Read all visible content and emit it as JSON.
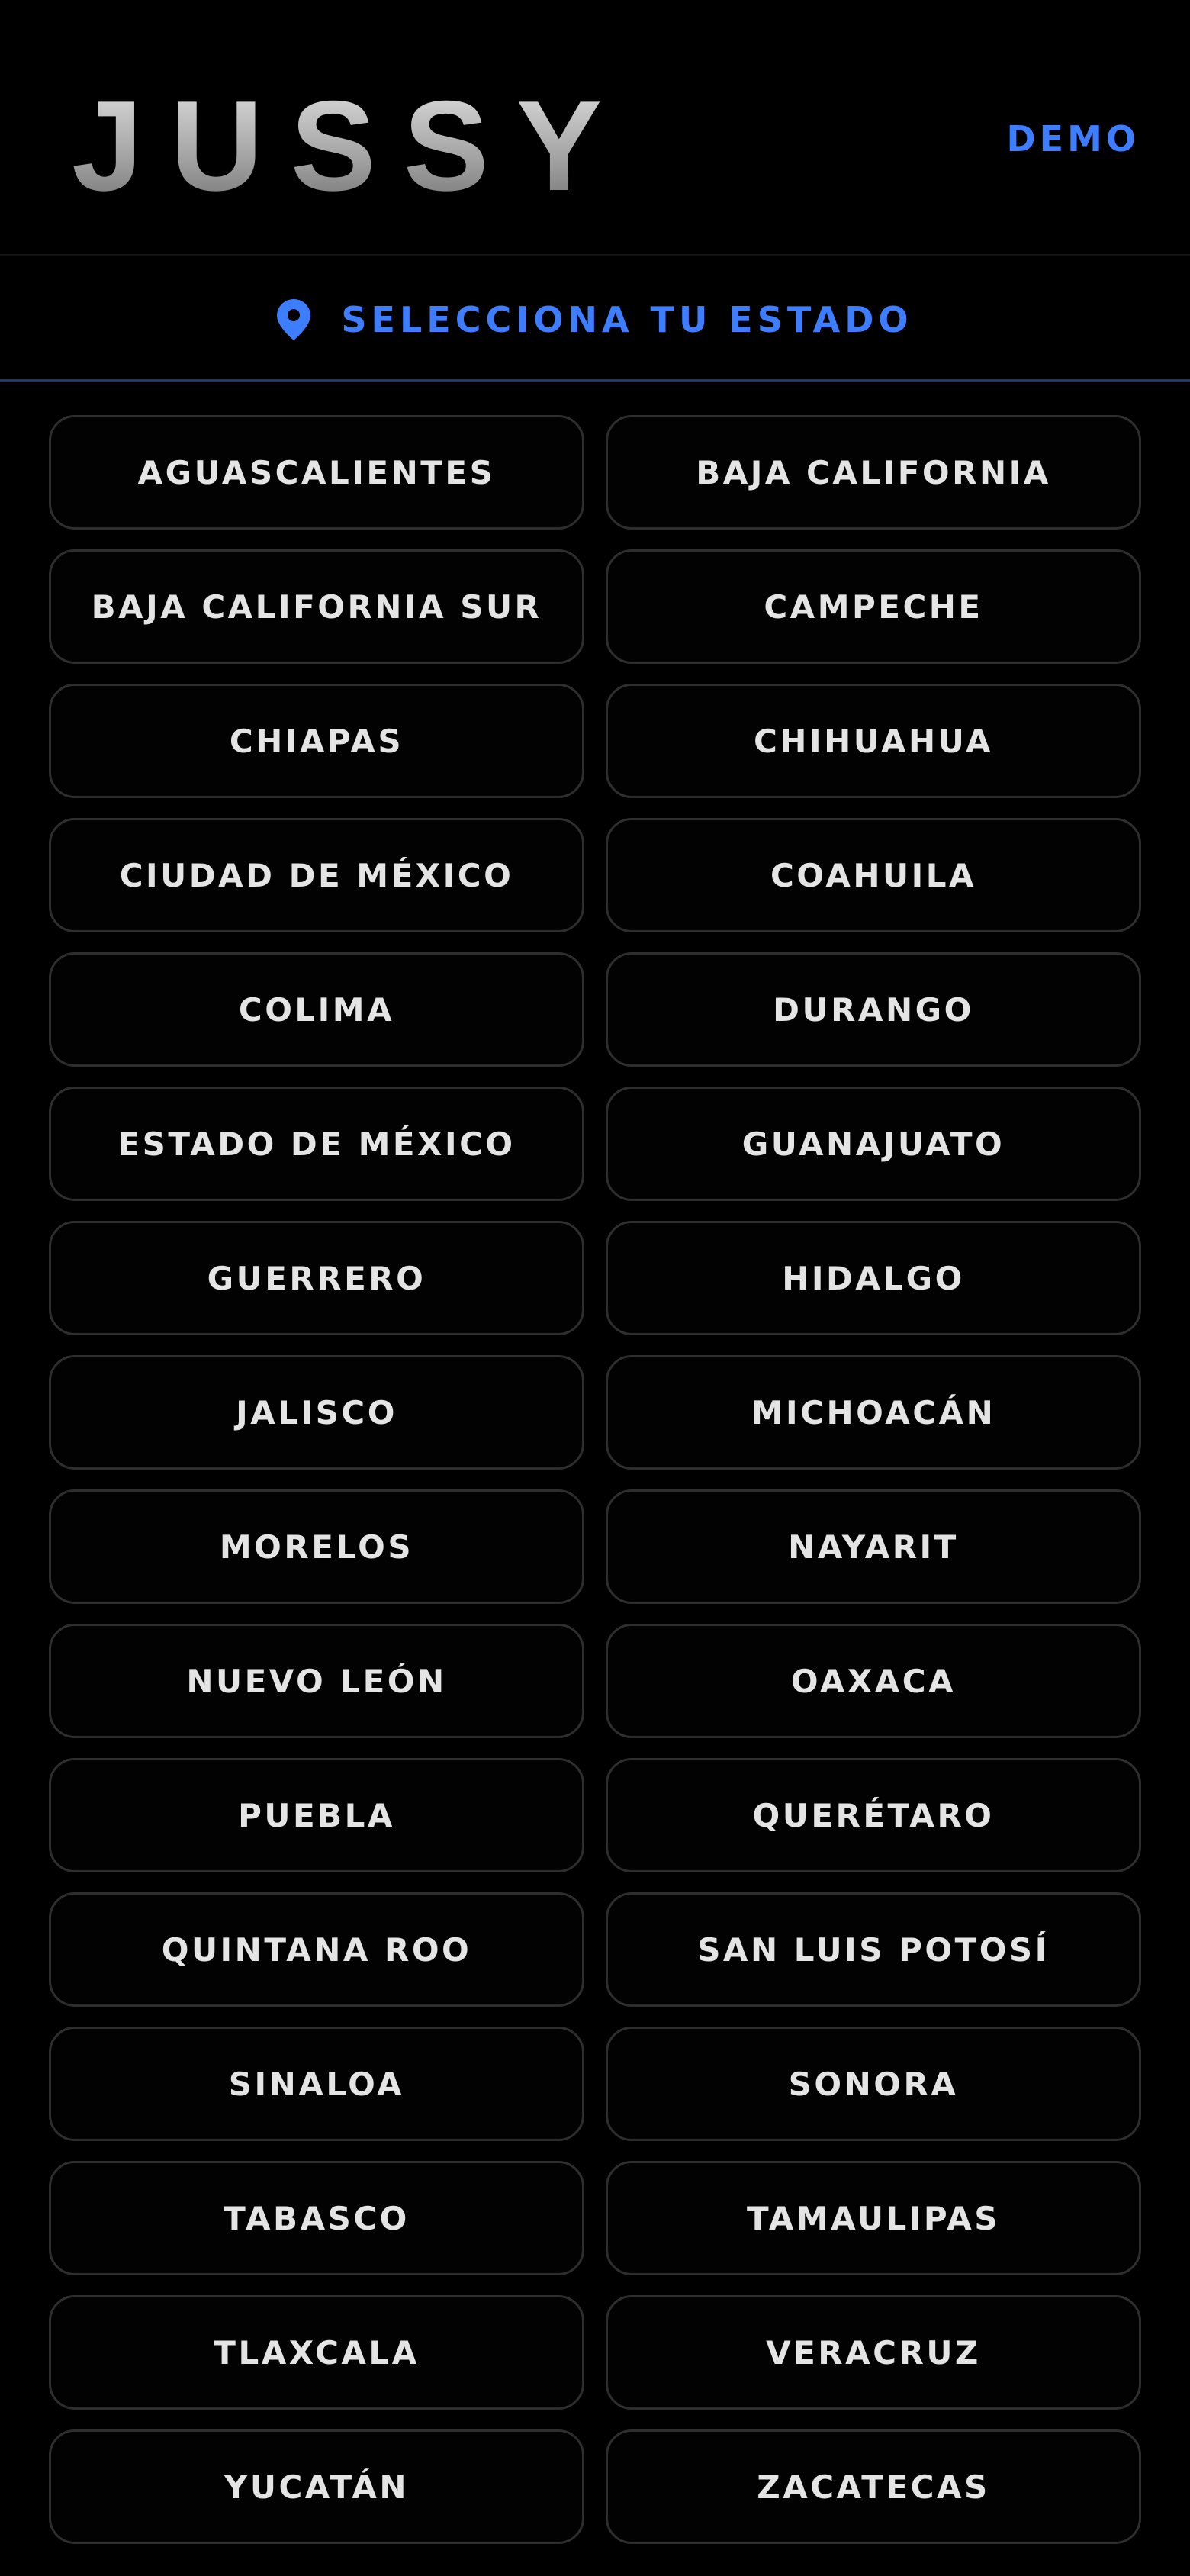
{
  "header": {
    "logo_text": "JUSSY",
    "demo_label": "DEMO"
  },
  "selector": {
    "icon": "map-pin-icon",
    "title": "SELECCIONA TU ESTADO"
  },
  "colors": {
    "background": "#000000",
    "accent": "#3d7dff",
    "button_border": "#2e2e2e",
    "button_text": "#e4e4e4"
  },
  "states": [
    "AGUASCALIENTES",
    "BAJA CALIFORNIA",
    "BAJA CALIFORNIA SUR",
    "CAMPECHE",
    "CHIAPAS",
    "CHIHUAHUA",
    "CIUDAD DE MÉXICO",
    "COAHUILA",
    "COLIMA",
    "DURANGO",
    "ESTADO DE MÉXICO",
    "GUANAJUATO",
    "GUERRERO",
    "HIDALGO",
    "JALISCO",
    "MICHOACÁN",
    "MORELOS",
    "NAYARIT",
    "NUEVO LEÓN",
    "OAXACA",
    "PUEBLA",
    "QUERÉTARO",
    "QUINTANA ROO",
    "SAN LUIS POTOSÍ",
    "SINALOA",
    "SONORA",
    "TABASCO",
    "TAMAULIPAS",
    "TLAXCALA",
    "VERACRUZ",
    "YUCATÁN",
    "ZACATECAS"
  ]
}
